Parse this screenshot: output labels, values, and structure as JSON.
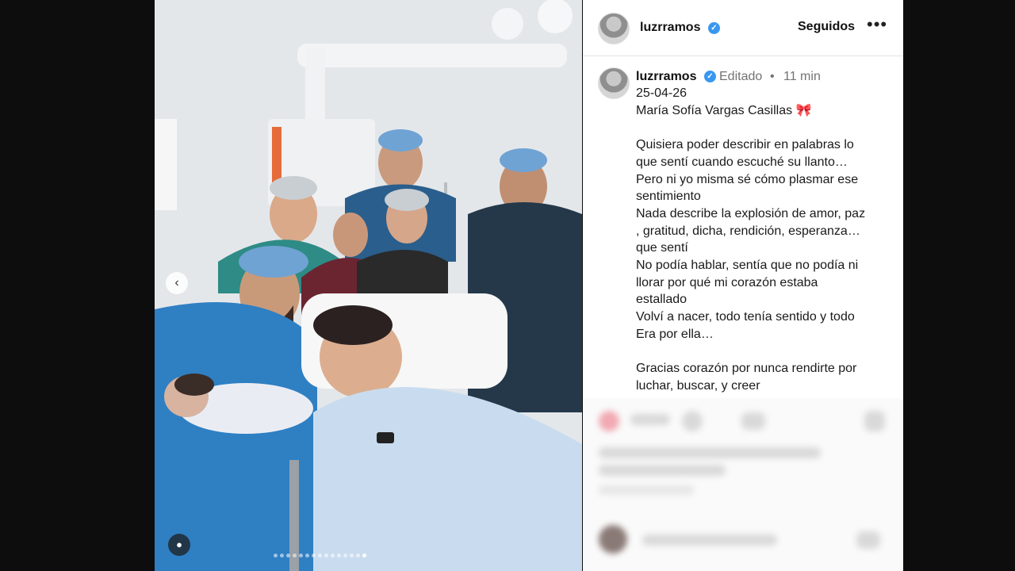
{
  "header": {
    "username": "luzrramos",
    "follow_label": "Seguidos",
    "more_icon": "more-icon"
  },
  "post": {
    "username": "luzrramos",
    "edited_label": "Editado",
    "separator": "•",
    "time_ago": "11 min",
    "caption_lines": [
      "25-04-26",
      "María Sofía Vargas Casillas 🎀",
      "",
      "Quisiera poder describir en palabras lo",
      "que sentí cuando escuché su llanto…",
      "Pero ni yo misma sé cómo plasmar ese",
      "sentimiento",
      "Nada describe la explosión de amor, paz",
      ", gratitud, dicha, rendición, esperanza…",
      "que sentí",
      "No podía hablar, sentía que no podía ni",
      "llorar por qué mi corazón estaba",
      "estallado",
      "Volví a nacer, todo tenía sentido y todo",
      "Era por ella…",
      "",
      "Gracias corazón por nunca rendirte por",
      "luchar, buscar, y creer"
    ]
  },
  "media": {
    "prev_icon": "chevron-left-icon",
    "tag_icon": "user-tag-icon",
    "carousel_total": 15,
    "carousel_active_index": 14
  },
  "colors": {
    "verified": "#3897f0",
    "scrub_blue": "#2f7fc3",
    "cap_blue": "#6fa3d3",
    "gown": "#c9dcef"
  }
}
